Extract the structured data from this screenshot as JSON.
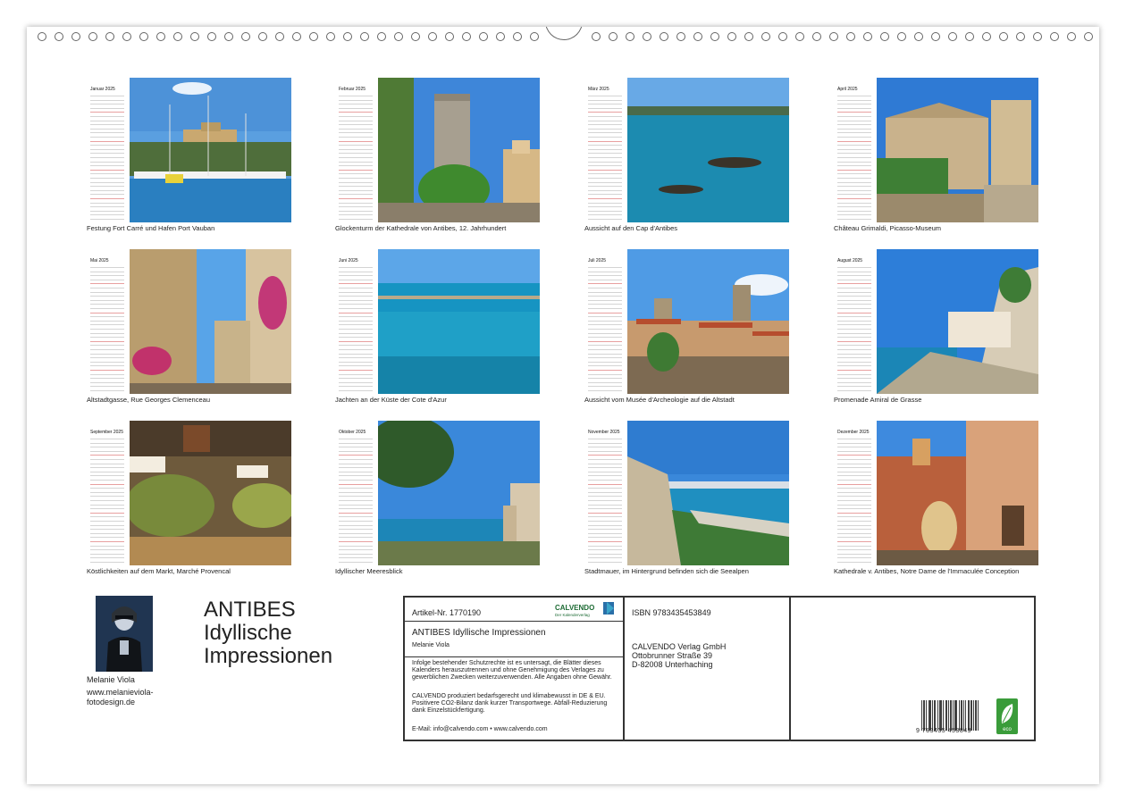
{
  "months": [
    {
      "name": "Januar 2025",
      "caption": "Festung Fort Carré und Hafen Port Vauban"
    },
    {
      "name": "Februar 2025",
      "caption": "Glockenturm der Kathedrale von Antibes, 12. Jahrhundert"
    },
    {
      "name": "März 2025",
      "caption": "Aussicht auf den Cap d'Antibes"
    },
    {
      "name": "April 2025",
      "caption": "Château Grimaldi, Picasso-Museum"
    },
    {
      "name": "Mai 2025",
      "caption": "Altstadtgasse, Rue Georges Clemenceau"
    },
    {
      "name": "Juni 2025",
      "caption": "Jachten an der Küste der Cote d'Azur"
    },
    {
      "name": "Juli 2025",
      "caption": "Aussicht vom Musée d'Archeologie auf die Altstadt"
    },
    {
      "name": "August 2025",
      "caption": "Promenade Amiral de Grasse"
    },
    {
      "name": "September 2025",
      "caption": "Köstlichkeiten auf dem Markt, Marché Provencal"
    },
    {
      "name": "Oktober 2025",
      "caption": "Idyllischer Meeresblick"
    },
    {
      "name": "November 2025",
      "caption": "Stadtmauer, im Hintergrund befinden sich die Seealpen"
    },
    {
      "name": "Dezember 2025",
      "caption": "Kathedrale v. Antibes, Notre Dame de l'Immaculée Conception"
    }
  ],
  "author": {
    "name": "Melanie Viola",
    "website": "www.melanieviola-fotodesign.de"
  },
  "title": {
    "line1": "ANTIBES",
    "line2": "Idyllische",
    "line3": "Impressionen"
  },
  "info": {
    "article": "Artikel-Nr. 1770190",
    "logo": "CALVENDO",
    "logo_sub": "Der Kalenderverlag",
    "product_title": "ANTIBES Idyllische Impressionen",
    "product_author": "Melanie Viola",
    "legal1": "Infolge bestehender Schutzrechte ist es untersagt, die Blätter dieses Kalenders herauszutrennen und ohne Genehmigung des Verlages zu gewerblichen Zwecken weiterzuverwenden. Alle Angaben ohne Gewähr.",
    "legal2": "CALVENDO produziert bedarfsgerecht und klimabewusst in DE & EU. Positivere CO2-Bilanz dank kurzer Transportwege. Abfall-Reduzierung dank Einzelstückfertigung.",
    "contact": "E-Mail: info@calvendo.com • www.calvendo.com",
    "isbn": "ISBN 9783435453849",
    "publisher1": "CALVENDO Verlag GmbH",
    "publisher2": "Ottobrunner Straße 39",
    "publisher3": "D-82008 Unterhaching",
    "barcode_number": "9 783435 453849",
    "eco_label": "eco"
  },
  "colors": {
    "sky": "#3a86d8",
    "sea": "#1f8fbf",
    "stone": "#c9b48d",
    "green": "#3d7a3a",
    "eco": "#3a9c3a"
  }
}
